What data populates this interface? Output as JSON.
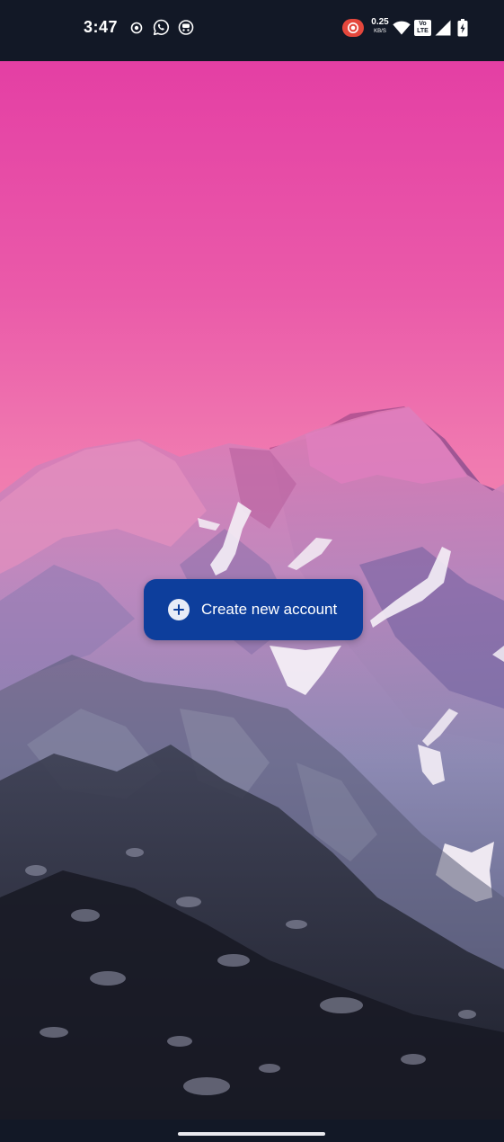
{
  "status_bar": {
    "time": "3:47",
    "net_speed_value": "0.25",
    "net_speed_unit": "KB/S",
    "volte_top": "Vo",
    "volte_bottom": "LTE",
    "icons": [
      "notification-dot-icon",
      "whatsapp-icon",
      "app-notification-icon",
      "screen-record-icon",
      "wifi-icon",
      "volte-icon",
      "cellular-signal-icon",
      "battery-charging-icon"
    ]
  },
  "main": {
    "create_account_label": "Create new account",
    "create_account_icon": "plus-circle-icon"
  },
  "colors": {
    "status_bar_bg": "#121826",
    "button_bg": "#0d3e9c",
    "sky_top": "#e43fa4",
    "sky_horizon": "#ef84ad"
  }
}
